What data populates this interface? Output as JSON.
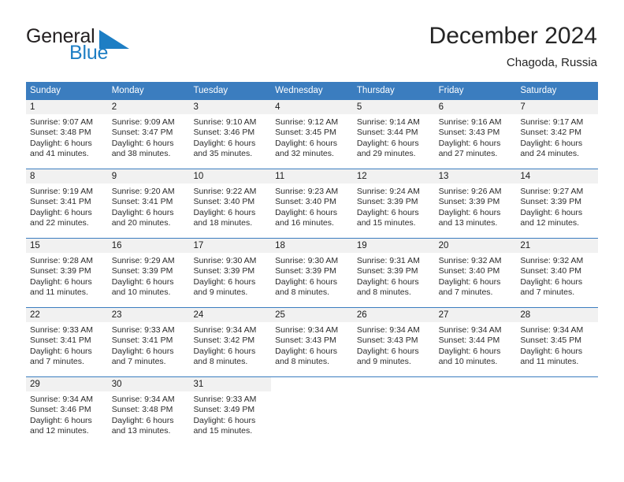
{
  "brand": {
    "name_part1": "General",
    "name_part2": "Blue",
    "mark": "triangle-flag-icon",
    "accent_color": "#1d7ec4"
  },
  "header": {
    "title": "December 2024",
    "subtitle": "Chagoda, Russia"
  },
  "theme": {
    "header_blue": "#3b7dbf",
    "daynum_background": "#f1f1f1",
    "text_color": "#2b2b2b"
  },
  "calendar": {
    "weekdays": [
      "Sunday",
      "Monday",
      "Tuesday",
      "Wednesday",
      "Thursday",
      "Friday",
      "Saturday"
    ],
    "weeks": [
      [
        {
          "day": "1",
          "sunrise": "Sunrise: 9:07 AM",
          "sunset": "Sunset: 3:48 PM",
          "daylight1": "Daylight: 6 hours",
          "daylight2": "and 41 minutes."
        },
        {
          "day": "2",
          "sunrise": "Sunrise: 9:09 AM",
          "sunset": "Sunset: 3:47 PM",
          "daylight1": "Daylight: 6 hours",
          "daylight2": "and 38 minutes."
        },
        {
          "day": "3",
          "sunrise": "Sunrise: 9:10 AM",
          "sunset": "Sunset: 3:46 PM",
          "daylight1": "Daylight: 6 hours",
          "daylight2": "and 35 minutes."
        },
        {
          "day": "4",
          "sunrise": "Sunrise: 9:12 AM",
          "sunset": "Sunset: 3:45 PM",
          "daylight1": "Daylight: 6 hours",
          "daylight2": "and 32 minutes."
        },
        {
          "day": "5",
          "sunrise": "Sunrise: 9:14 AM",
          "sunset": "Sunset: 3:44 PM",
          "daylight1": "Daylight: 6 hours",
          "daylight2": "and 29 minutes."
        },
        {
          "day": "6",
          "sunrise": "Sunrise: 9:16 AM",
          "sunset": "Sunset: 3:43 PM",
          "daylight1": "Daylight: 6 hours",
          "daylight2": "and 27 minutes."
        },
        {
          "day": "7",
          "sunrise": "Sunrise: 9:17 AM",
          "sunset": "Sunset: 3:42 PM",
          "daylight1": "Daylight: 6 hours",
          "daylight2": "and 24 minutes."
        }
      ],
      [
        {
          "day": "8",
          "sunrise": "Sunrise: 9:19 AM",
          "sunset": "Sunset: 3:41 PM",
          "daylight1": "Daylight: 6 hours",
          "daylight2": "and 22 minutes."
        },
        {
          "day": "9",
          "sunrise": "Sunrise: 9:20 AM",
          "sunset": "Sunset: 3:41 PM",
          "daylight1": "Daylight: 6 hours",
          "daylight2": "and 20 minutes."
        },
        {
          "day": "10",
          "sunrise": "Sunrise: 9:22 AM",
          "sunset": "Sunset: 3:40 PM",
          "daylight1": "Daylight: 6 hours",
          "daylight2": "and 18 minutes."
        },
        {
          "day": "11",
          "sunrise": "Sunrise: 9:23 AM",
          "sunset": "Sunset: 3:40 PM",
          "daylight1": "Daylight: 6 hours",
          "daylight2": "and 16 minutes."
        },
        {
          "day": "12",
          "sunrise": "Sunrise: 9:24 AM",
          "sunset": "Sunset: 3:39 PM",
          "daylight1": "Daylight: 6 hours",
          "daylight2": "and 15 minutes."
        },
        {
          "day": "13",
          "sunrise": "Sunrise: 9:26 AM",
          "sunset": "Sunset: 3:39 PM",
          "daylight1": "Daylight: 6 hours",
          "daylight2": "and 13 minutes."
        },
        {
          "day": "14",
          "sunrise": "Sunrise: 9:27 AM",
          "sunset": "Sunset: 3:39 PM",
          "daylight1": "Daylight: 6 hours",
          "daylight2": "and 12 minutes."
        }
      ],
      [
        {
          "day": "15",
          "sunrise": "Sunrise: 9:28 AM",
          "sunset": "Sunset: 3:39 PM",
          "daylight1": "Daylight: 6 hours",
          "daylight2": "and 11 minutes."
        },
        {
          "day": "16",
          "sunrise": "Sunrise: 9:29 AM",
          "sunset": "Sunset: 3:39 PM",
          "daylight1": "Daylight: 6 hours",
          "daylight2": "and 10 minutes."
        },
        {
          "day": "17",
          "sunrise": "Sunrise: 9:30 AM",
          "sunset": "Sunset: 3:39 PM",
          "daylight1": "Daylight: 6 hours",
          "daylight2": "and 9 minutes."
        },
        {
          "day": "18",
          "sunrise": "Sunrise: 9:30 AM",
          "sunset": "Sunset: 3:39 PM",
          "daylight1": "Daylight: 6 hours",
          "daylight2": "and 8 minutes."
        },
        {
          "day": "19",
          "sunrise": "Sunrise: 9:31 AM",
          "sunset": "Sunset: 3:39 PM",
          "daylight1": "Daylight: 6 hours",
          "daylight2": "and 8 minutes."
        },
        {
          "day": "20",
          "sunrise": "Sunrise: 9:32 AM",
          "sunset": "Sunset: 3:40 PM",
          "daylight1": "Daylight: 6 hours",
          "daylight2": "and 7 minutes."
        },
        {
          "day": "21",
          "sunrise": "Sunrise: 9:32 AM",
          "sunset": "Sunset: 3:40 PM",
          "daylight1": "Daylight: 6 hours",
          "daylight2": "and 7 minutes."
        }
      ],
      [
        {
          "day": "22",
          "sunrise": "Sunrise: 9:33 AM",
          "sunset": "Sunset: 3:41 PM",
          "daylight1": "Daylight: 6 hours",
          "daylight2": "and 7 minutes."
        },
        {
          "day": "23",
          "sunrise": "Sunrise: 9:33 AM",
          "sunset": "Sunset: 3:41 PM",
          "daylight1": "Daylight: 6 hours",
          "daylight2": "and 7 minutes."
        },
        {
          "day": "24",
          "sunrise": "Sunrise: 9:34 AM",
          "sunset": "Sunset: 3:42 PM",
          "daylight1": "Daylight: 6 hours",
          "daylight2": "and 8 minutes."
        },
        {
          "day": "25",
          "sunrise": "Sunrise: 9:34 AM",
          "sunset": "Sunset: 3:43 PM",
          "daylight1": "Daylight: 6 hours",
          "daylight2": "and 8 minutes."
        },
        {
          "day": "26",
          "sunrise": "Sunrise: 9:34 AM",
          "sunset": "Sunset: 3:43 PM",
          "daylight1": "Daylight: 6 hours",
          "daylight2": "and 9 minutes."
        },
        {
          "day": "27",
          "sunrise": "Sunrise: 9:34 AM",
          "sunset": "Sunset: 3:44 PM",
          "daylight1": "Daylight: 6 hours",
          "daylight2": "and 10 minutes."
        },
        {
          "day": "28",
          "sunrise": "Sunrise: 9:34 AM",
          "sunset": "Sunset: 3:45 PM",
          "daylight1": "Daylight: 6 hours",
          "daylight2": "and 11 minutes."
        }
      ],
      [
        {
          "day": "29",
          "sunrise": "Sunrise: 9:34 AM",
          "sunset": "Sunset: 3:46 PM",
          "daylight1": "Daylight: 6 hours",
          "daylight2": "and 12 minutes."
        },
        {
          "day": "30",
          "sunrise": "Sunrise: 9:34 AM",
          "sunset": "Sunset: 3:48 PM",
          "daylight1": "Daylight: 6 hours",
          "daylight2": "and 13 minutes."
        },
        {
          "day": "31",
          "sunrise": "Sunrise: 9:33 AM",
          "sunset": "Sunset: 3:49 PM",
          "daylight1": "Daylight: 6 hours",
          "daylight2": "and 15 minutes."
        },
        {
          "day": "",
          "sunrise": "",
          "sunset": "",
          "daylight1": "",
          "daylight2": ""
        },
        {
          "day": "",
          "sunrise": "",
          "sunset": "",
          "daylight1": "",
          "daylight2": ""
        },
        {
          "day": "",
          "sunrise": "",
          "sunset": "",
          "daylight1": "",
          "daylight2": ""
        },
        {
          "day": "",
          "sunrise": "",
          "sunset": "",
          "daylight1": "",
          "daylight2": ""
        }
      ]
    ]
  }
}
